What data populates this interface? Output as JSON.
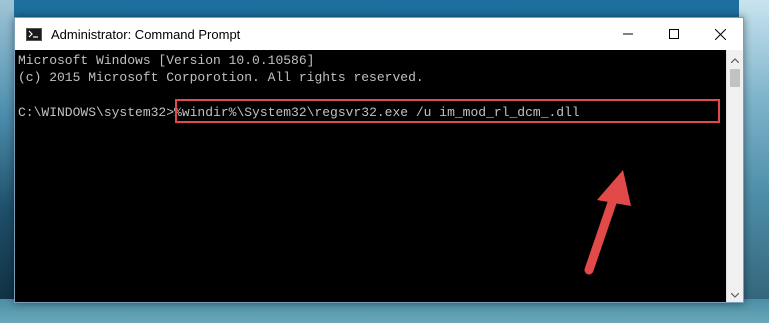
{
  "window": {
    "title": "Administrator: Command Prompt",
    "icon": "cmd-icon"
  },
  "controls": {
    "minimize_icon": "minimize-icon",
    "maximize_icon": "maximize-icon",
    "close_icon": "close-icon"
  },
  "console": {
    "line1": "Microsoft Windows [Version 10.0.10586]",
    "line2": "(c) 2015 Microsoft Corporotion. All rights reserved.",
    "prompt": "C:\\WINDOWS\\system32>",
    "command": "%windir%\\System32\\regsvr32.exe /u im_mod_rl_dcm_.dll"
  },
  "annotations": {
    "highlight_color": "#e24a4a",
    "arrow_color": "#e24a4a"
  }
}
